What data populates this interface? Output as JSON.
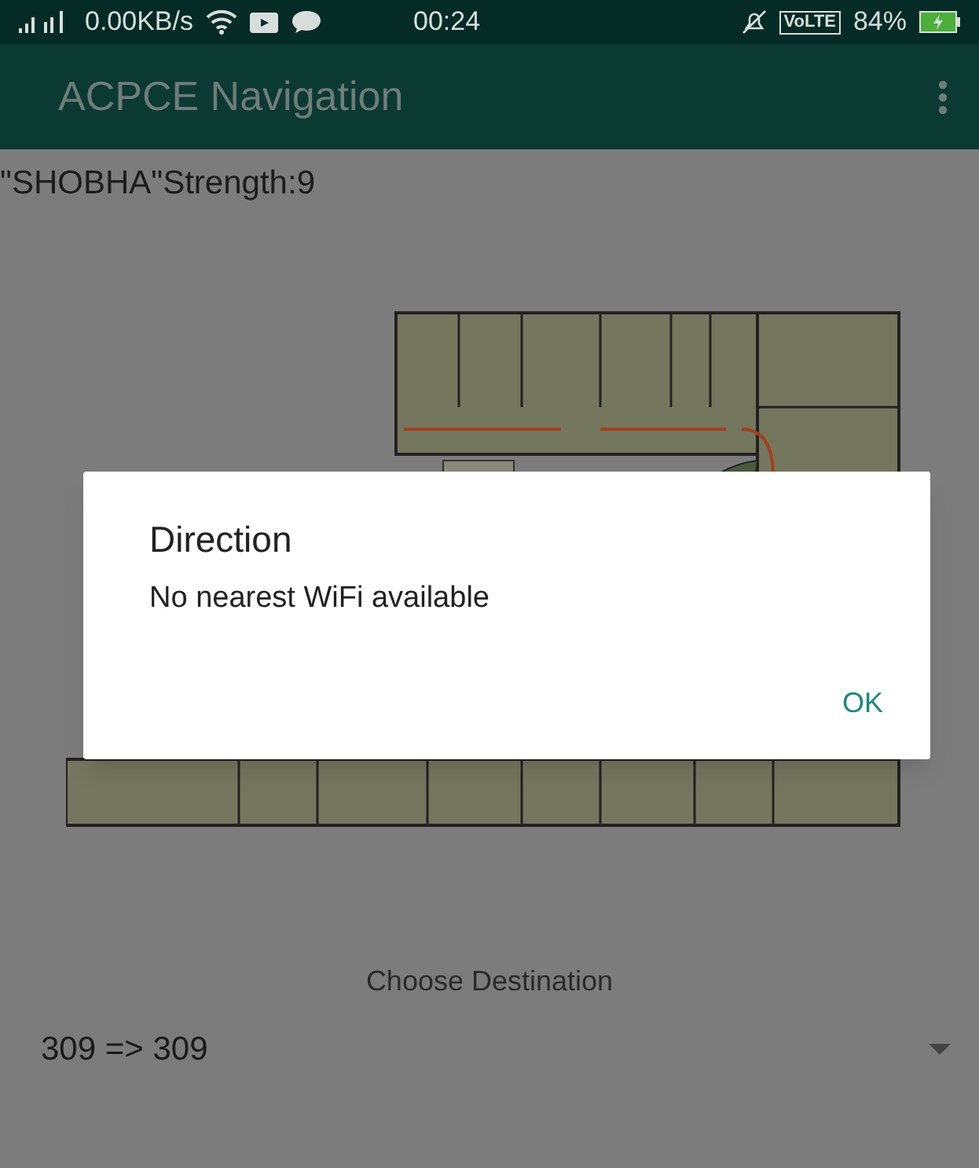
{
  "status_bar": {
    "network_speed": "0.00KB/s",
    "time": "00:24",
    "network_type": "VoLTE",
    "battery": "84%"
  },
  "app_bar": {
    "title": "ACPCE Navigation"
  },
  "wifi_status": "\"SHOBHA\"Strength:9",
  "dialog": {
    "title": "Direction",
    "message": "No nearest WiFi available",
    "buttons": [
      "OK"
    ]
  },
  "destination": {
    "label": "Choose Destination",
    "value": "309 => 309"
  }
}
